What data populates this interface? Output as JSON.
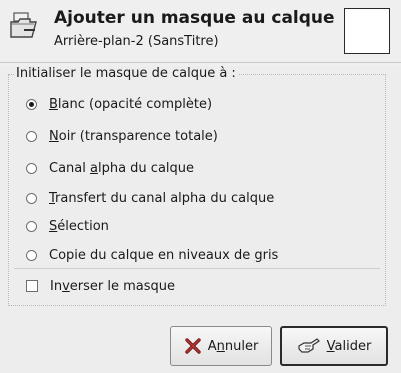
{
  "header": {
    "icon": "add-layer-mask-icon",
    "title": "Ajouter un masque au calque",
    "subtitle": "Arrière-plan-2 (SansTitre)"
  },
  "group": {
    "title": "Initialiser le masque de calque à :",
    "options": [
      {
        "pre": "",
        "u": "B",
        "post": "lanc (opacité complète)",
        "checked": true
      },
      {
        "pre": "",
        "u": "N",
        "post": "oir (transparence totale)",
        "checked": false
      },
      {
        "pre": "Canal ",
        "u": "a",
        "post": "lpha du calque",
        "checked": false
      },
      {
        "pre": "",
        "u": "T",
        "post": "ransfert du canal alpha du calque",
        "checked": false
      },
      {
        "pre": "",
        "u": "S",
        "post": "élection",
        "checked": false
      },
      {
        "pre": "Copie du calque en niveaux de ",
        "u": "g",
        "post": "ris",
        "checked": false
      }
    ],
    "invert": {
      "pre": "In",
      "u": "v",
      "post": "erser le masque",
      "checked": false
    }
  },
  "buttons": {
    "cancel": {
      "pre": "A",
      "u": "n",
      "post": "nuler",
      "icon": "cancel-x-icon"
    },
    "ok": {
      "pre": "",
      "u": "V",
      "post": "alider",
      "icon": "ok-hand-icon"
    }
  },
  "colors": {
    "cancel_icon": "#7a1a1a"
  }
}
